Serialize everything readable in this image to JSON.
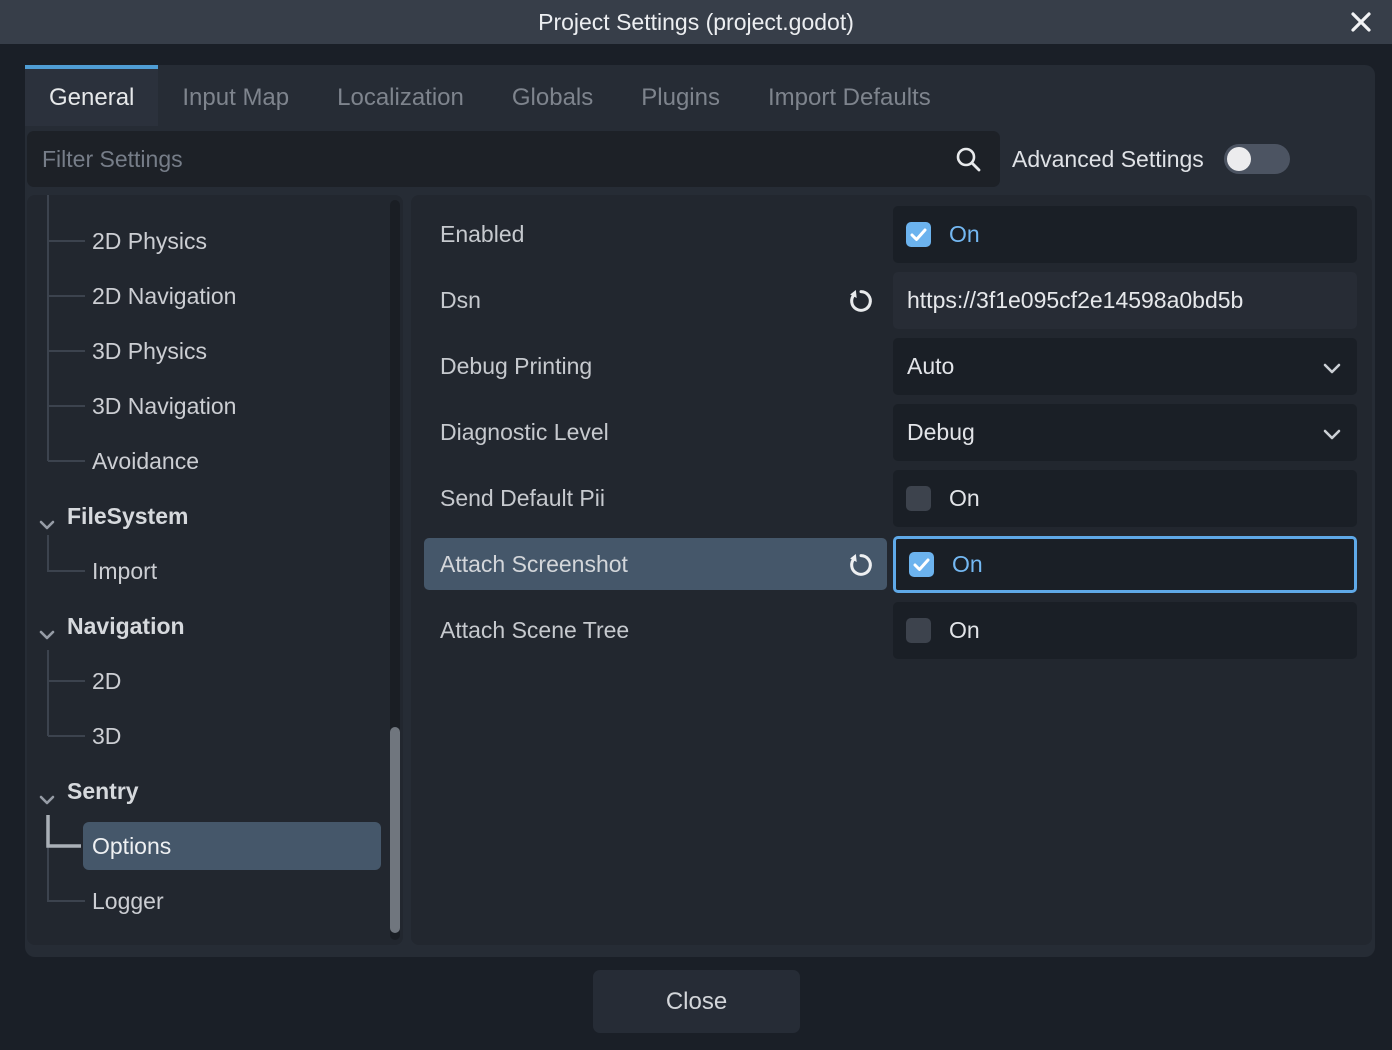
{
  "window": {
    "title": "Project Settings (project.godot)"
  },
  "tabs": [
    {
      "label": "General",
      "active": true
    },
    {
      "label": "Input Map",
      "active": false
    },
    {
      "label": "Localization",
      "active": false
    },
    {
      "label": "Globals",
      "active": false
    },
    {
      "label": "Plugins",
      "active": false
    },
    {
      "label": "Import Defaults",
      "active": false
    }
  ],
  "filter": {
    "placeholder": "Filter Settings",
    "advanced_label": "Advanced Settings",
    "advanced_enabled": false
  },
  "sidebar": {
    "items": [
      {
        "label": "2D Physics",
        "type": "child"
      },
      {
        "label": "2D Navigation",
        "type": "child"
      },
      {
        "label": "3D Physics",
        "type": "child"
      },
      {
        "label": "3D Navigation",
        "type": "child"
      },
      {
        "label": "Avoidance",
        "type": "child"
      },
      {
        "label": "FileSystem",
        "type": "section",
        "expanded": true
      },
      {
        "label": "Import",
        "type": "child"
      },
      {
        "label": "Navigation",
        "type": "section",
        "expanded": true
      },
      {
        "label": "2D",
        "type": "child"
      },
      {
        "label": "3D",
        "type": "child"
      },
      {
        "label": "Sentry",
        "type": "section",
        "expanded": true
      },
      {
        "label": "Options",
        "type": "child",
        "selected": true
      },
      {
        "label": "Logger",
        "type": "child"
      }
    ]
  },
  "settings": [
    {
      "label": "Enabled",
      "control": "checkbox",
      "checked": true,
      "value": "On"
    },
    {
      "label": "Dsn",
      "control": "text",
      "value": "https://3f1e095cf2e14598a0bd5b",
      "revert": true
    },
    {
      "label": "Debug Printing",
      "control": "dropdown",
      "value": "Auto"
    },
    {
      "label": "Diagnostic Level",
      "control": "dropdown",
      "value": "Debug"
    },
    {
      "label": "Send Default Pii",
      "control": "checkbox",
      "checked": false,
      "value": "On"
    },
    {
      "label": "Attach Screenshot",
      "control": "checkbox",
      "checked": true,
      "value": "On",
      "revert": true,
      "highlighted": true,
      "focused": true
    },
    {
      "label": "Attach Scene Tree",
      "control": "checkbox",
      "checked": false,
      "value": "On"
    }
  ],
  "footer": {
    "close_label": "Close"
  },
  "icons": {
    "close": "x-cross",
    "search": "magnifying-glass",
    "revert": "counterclockwise-arrow",
    "fold": "chevron-down",
    "dropdown": "chevron-down",
    "check": "checkmark"
  },
  "colors": {
    "accent_blue": "#4f9dd4",
    "checkbox_blue": "#6cb3ee",
    "on_text_blue": "#74b8f2",
    "selection": "#45576a",
    "focus_border": "#5fa9e8",
    "titlebar": "#373e49",
    "panel": "#22272f"
  }
}
